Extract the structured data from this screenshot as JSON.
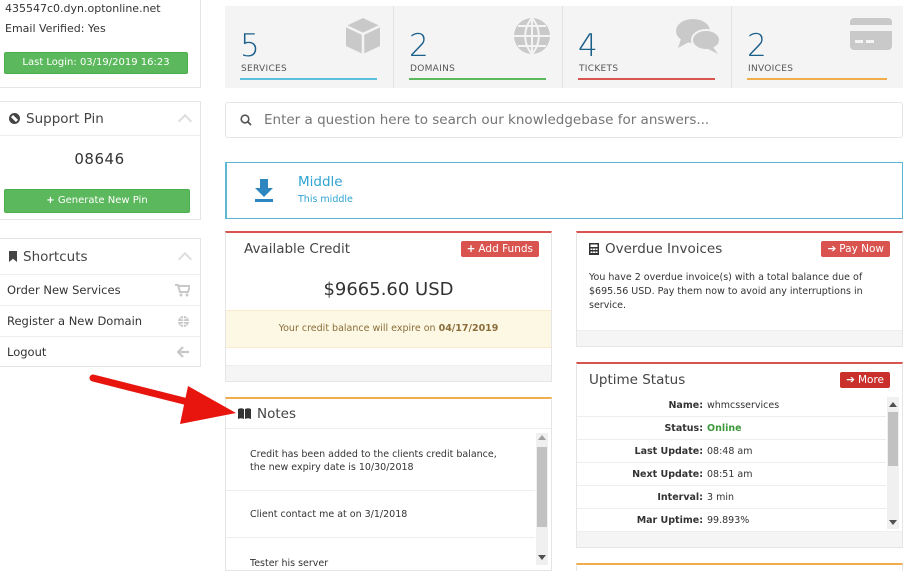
{
  "client": {
    "hostname": "435547c0.dyn.optonline.net",
    "email_verified": "Email Verified: Yes",
    "last_login": "Last Login: 03/19/2019 16:23"
  },
  "support_pin": {
    "title": "Support Pin",
    "pin": "08646",
    "generate_label": "Generate New Pin"
  },
  "shortcuts": {
    "title": "Shortcuts",
    "items": [
      {
        "label": "Order New Services",
        "icon": "cart-icon"
      },
      {
        "label": "Register a New Domain",
        "icon": "globe-icon"
      },
      {
        "label": "Logout",
        "icon": "arrow-left-icon"
      }
    ]
  },
  "stats": [
    {
      "value": "5",
      "label": "SERVICES",
      "color": "#5bc0de",
      "icon": "cube-icon"
    },
    {
      "value": "2",
      "label": "DOMAINS",
      "color": "#5cb85c",
      "icon": "globe-icon"
    },
    {
      "value": "4",
      "label": "TICKETS",
      "color": "#d9534f",
      "icon": "comments-icon"
    },
    {
      "value": "2",
      "label": "INVOICES",
      "color": "#f0ad4e",
      "icon": "credit-card-icon"
    }
  ],
  "search": {
    "placeholder": "Enter a question here to search our knowledgebase for answers..."
  },
  "announcement": {
    "title": "Middle",
    "subtitle": "This middle"
  },
  "credit": {
    "title": "Available Credit",
    "add_funds": "Add Funds",
    "amount": "$9665.60 USD",
    "expiry_text": "Your credit balance will expire on ",
    "expiry_date": "04/17/2019"
  },
  "overdue": {
    "title": "Overdue Invoices",
    "pay_now": "Pay Now",
    "message": "You have 2 overdue invoice(s) with a total balance due of $695.56 USD. Pay them now to avoid any interruptions in service."
  },
  "notes": {
    "title": "Notes",
    "items": [
      "Credit has been added to the clients credit balance, the new expiry date is 10/30/2018",
      "Client contact me at on 3/1/2018",
      "Tester his server"
    ]
  },
  "uptime": {
    "title": "Uptime Status",
    "more": "More",
    "rows": [
      {
        "key": "Name:",
        "value": "whmcsservices"
      },
      {
        "key": "Status:",
        "value": "Online"
      },
      {
        "key": "Last Update:",
        "value": "08:48 am"
      },
      {
        "key": "Next Update:",
        "value": "08:51 am"
      },
      {
        "key": "Interval:",
        "value": "3 min"
      },
      {
        "key": "Mar Uptime:",
        "value": "99.893%"
      }
    ]
  },
  "colors": {
    "accent_blue": "#1a5e8a",
    "link_blue": "#2fa3d3",
    "green": "#5cb85c",
    "red": "#d9534f",
    "orange": "#f0ad4e",
    "annotation_arrow": "#e8140e"
  }
}
